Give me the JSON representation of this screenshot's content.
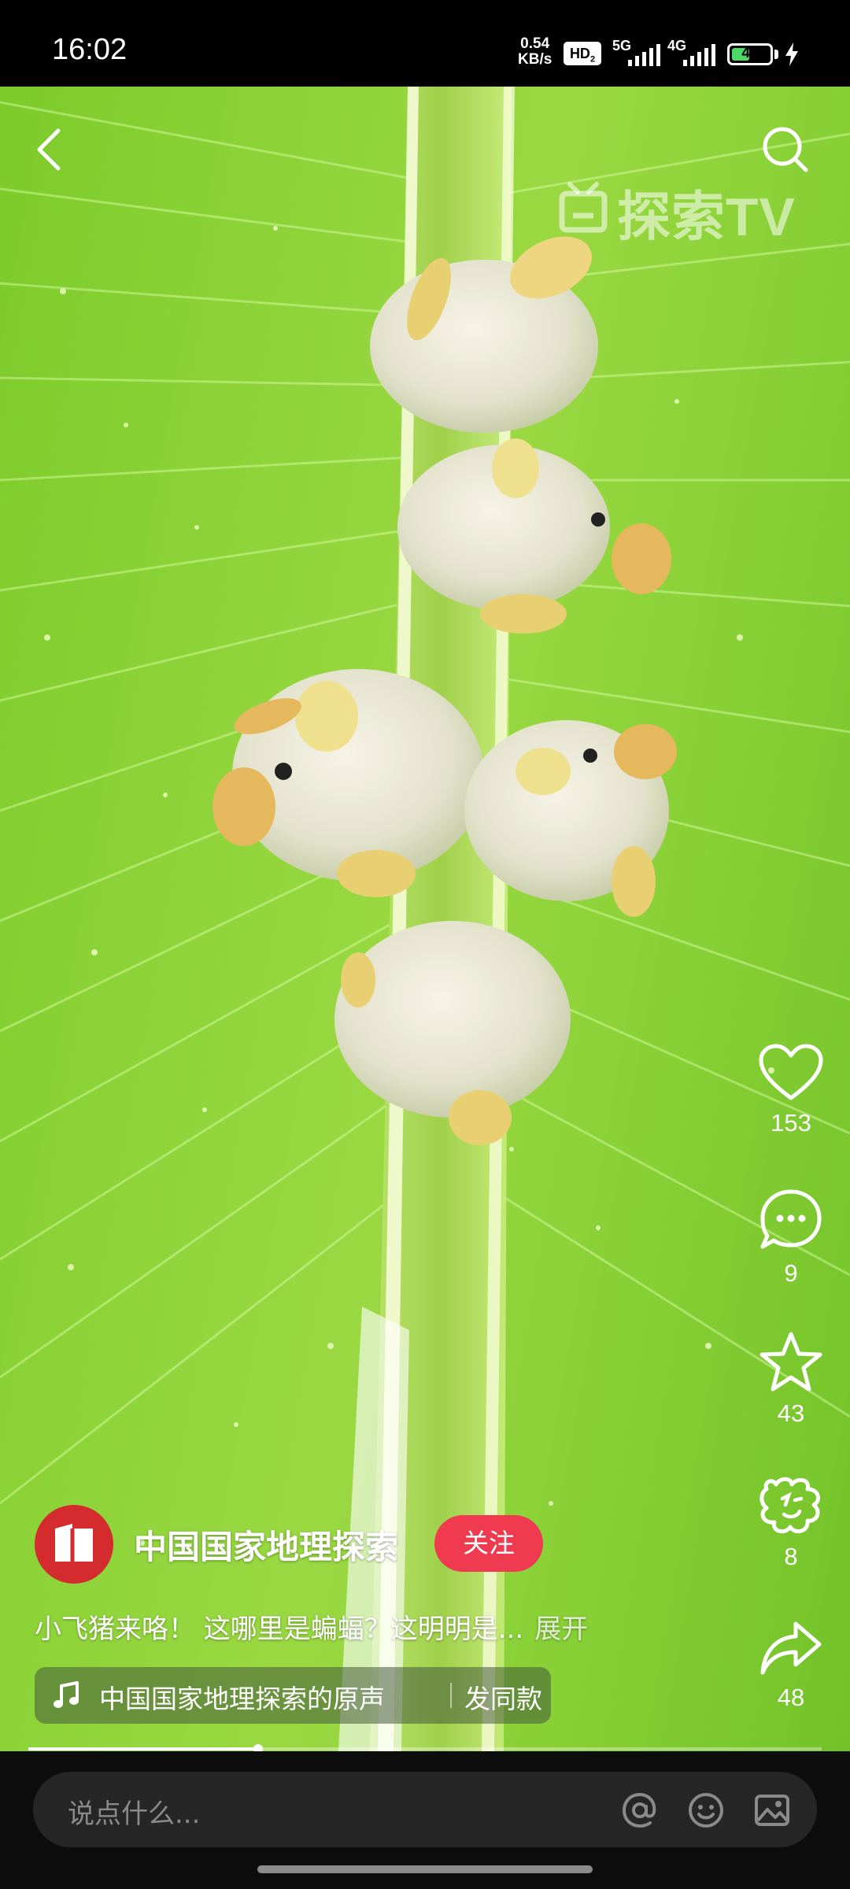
{
  "status_bar": {
    "time": "16:02",
    "net_speed_value": "0.54",
    "net_speed_unit": "KB/s",
    "hd_badge": "HD",
    "signal_1_label": "5G",
    "signal_2_label": "4G",
    "battery": "48",
    "battery_level": 0.48,
    "charging": true
  },
  "video": {
    "watermark": "探索TV",
    "progress": 0.29
  },
  "top_bar": {
    "back_icon": "back-arrow-icon",
    "search_icon": "search-icon"
  },
  "actions": {
    "like": {
      "icon": "heart-icon",
      "count": "153"
    },
    "comment": {
      "icon": "comment-bubble-icon",
      "count": "9"
    },
    "favorite": {
      "icon": "star-icon",
      "count": "43"
    },
    "gift": {
      "icon": "emoji-gift-icon",
      "count": "8"
    },
    "share": {
      "icon": "share-arrow-icon",
      "count": "48"
    }
  },
  "author": {
    "name": "中国国家地理探索",
    "follow_label": "关注",
    "avatar_color": "#d42b2f"
  },
  "caption": {
    "text": "小飞猪来咯！ 这哪里是蝙蝠？这明明是...",
    "more_label": "展开"
  },
  "music": {
    "icon": "music-note-icon",
    "name": "中国国家地理探索的原声",
    "use_same_label": "发同款"
  },
  "comment_bar": {
    "placeholder": "说点什么...",
    "icons": [
      "at-icon",
      "emoji-icon",
      "image-icon"
    ]
  },
  "colors": {
    "accent": "#f03a4f",
    "leaf_green": "#8fd43a",
    "battery_green": "#4cd964"
  }
}
